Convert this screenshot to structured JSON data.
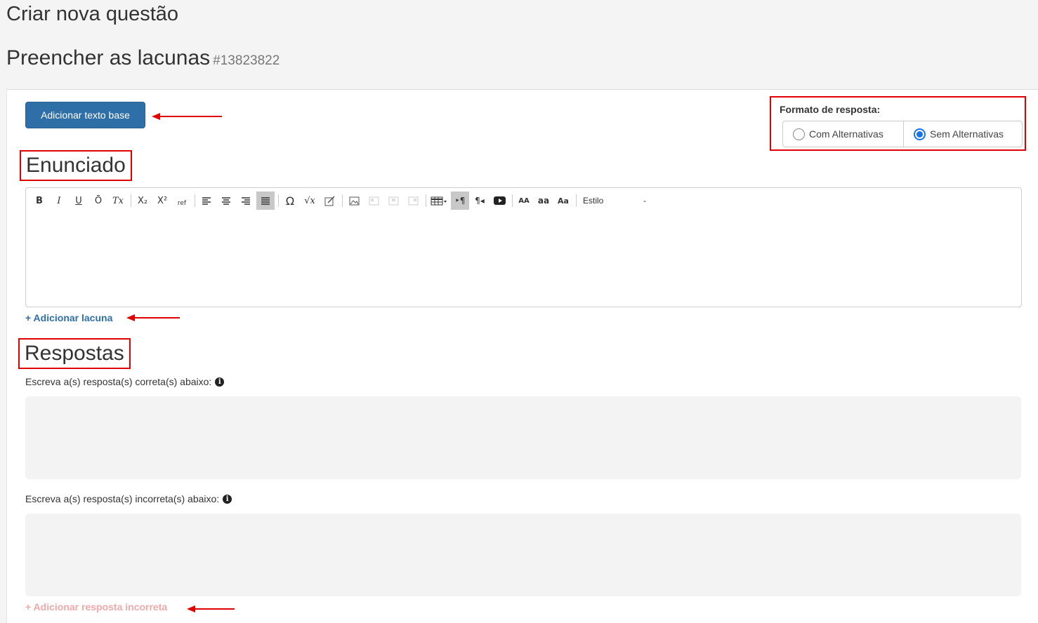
{
  "header": {
    "title": "Criar nova questão",
    "subtitle": "Preencher as lacunas",
    "question_id": "#13823822"
  },
  "actions": {
    "add_base_text": "Adicionar texto base",
    "add_gap": "Adicionar lacuna",
    "add_incorrect": "Adicionar resposta incorreta"
  },
  "format": {
    "label": "Formato de resposta:",
    "options": [
      {
        "label": "Com Alternativas",
        "selected": false
      },
      {
        "label": "Sem Alternativas",
        "selected": true
      }
    ]
  },
  "sections": {
    "statement": "Enunciado",
    "answers": "Respostas"
  },
  "editor": {
    "toolbar": {
      "bold": "B",
      "italic": "I",
      "underline": "U",
      "overline": "Ō",
      "clear_format": "Tx",
      "subscript": "X₂",
      "superscript": "X²",
      "ref": "ref",
      "style_label": "Estilo",
      "style_caret": "-"
    }
  },
  "answers": {
    "correct_label": "Escreva a(s) resposta(s) correta(s) abaixo:",
    "incorrect_label": "Escreva a(s) resposta(s) incorreta(s) abaixo:",
    "info_icon": "info-icon"
  },
  "colors": {
    "primary": "#2f6fa8",
    "annotation_red": "#e00000",
    "radio_selected": "#1a73e8"
  }
}
